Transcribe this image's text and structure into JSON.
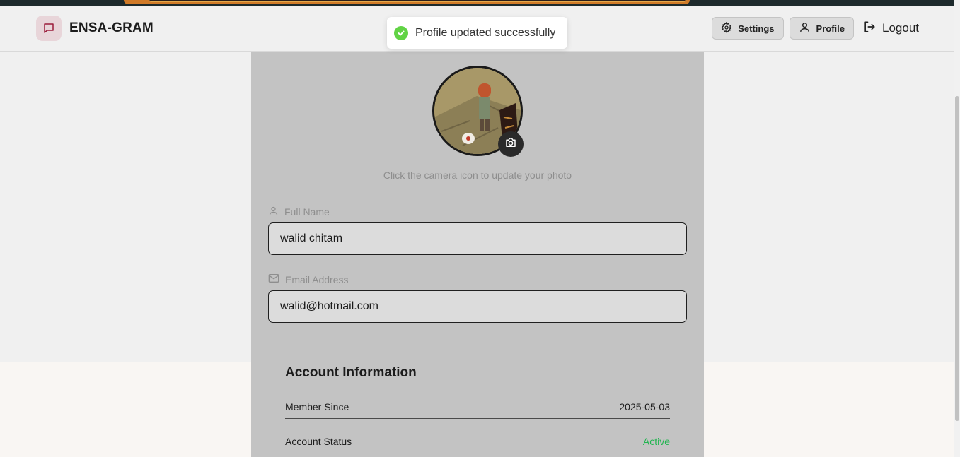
{
  "brand": {
    "name": "ENSA-GRAM",
    "logo_icon": "chat-bubble-icon",
    "accent": "#e8d5d9"
  },
  "nav": {
    "settings_label": "Settings",
    "profile_label": "Profile",
    "logout_label": "Logout"
  },
  "toast": {
    "message": "Profile updated successfully",
    "color": "#61d345"
  },
  "profile": {
    "avatar_hint": "Click the camera icon to update your photo",
    "full_name_label": "Full Name",
    "full_name_value": "walid chitam",
    "email_label": "Email Address",
    "email_value": "walid@hotmail.com"
  },
  "account": {
    "title": "Account Information",
    "member_since_label": "Member Since",
    "member_since_value": "2025-05-03",
    "status_label": "Account Status",
    "status_value": "Active",
    "status_color": "#22b550"
  }
}
